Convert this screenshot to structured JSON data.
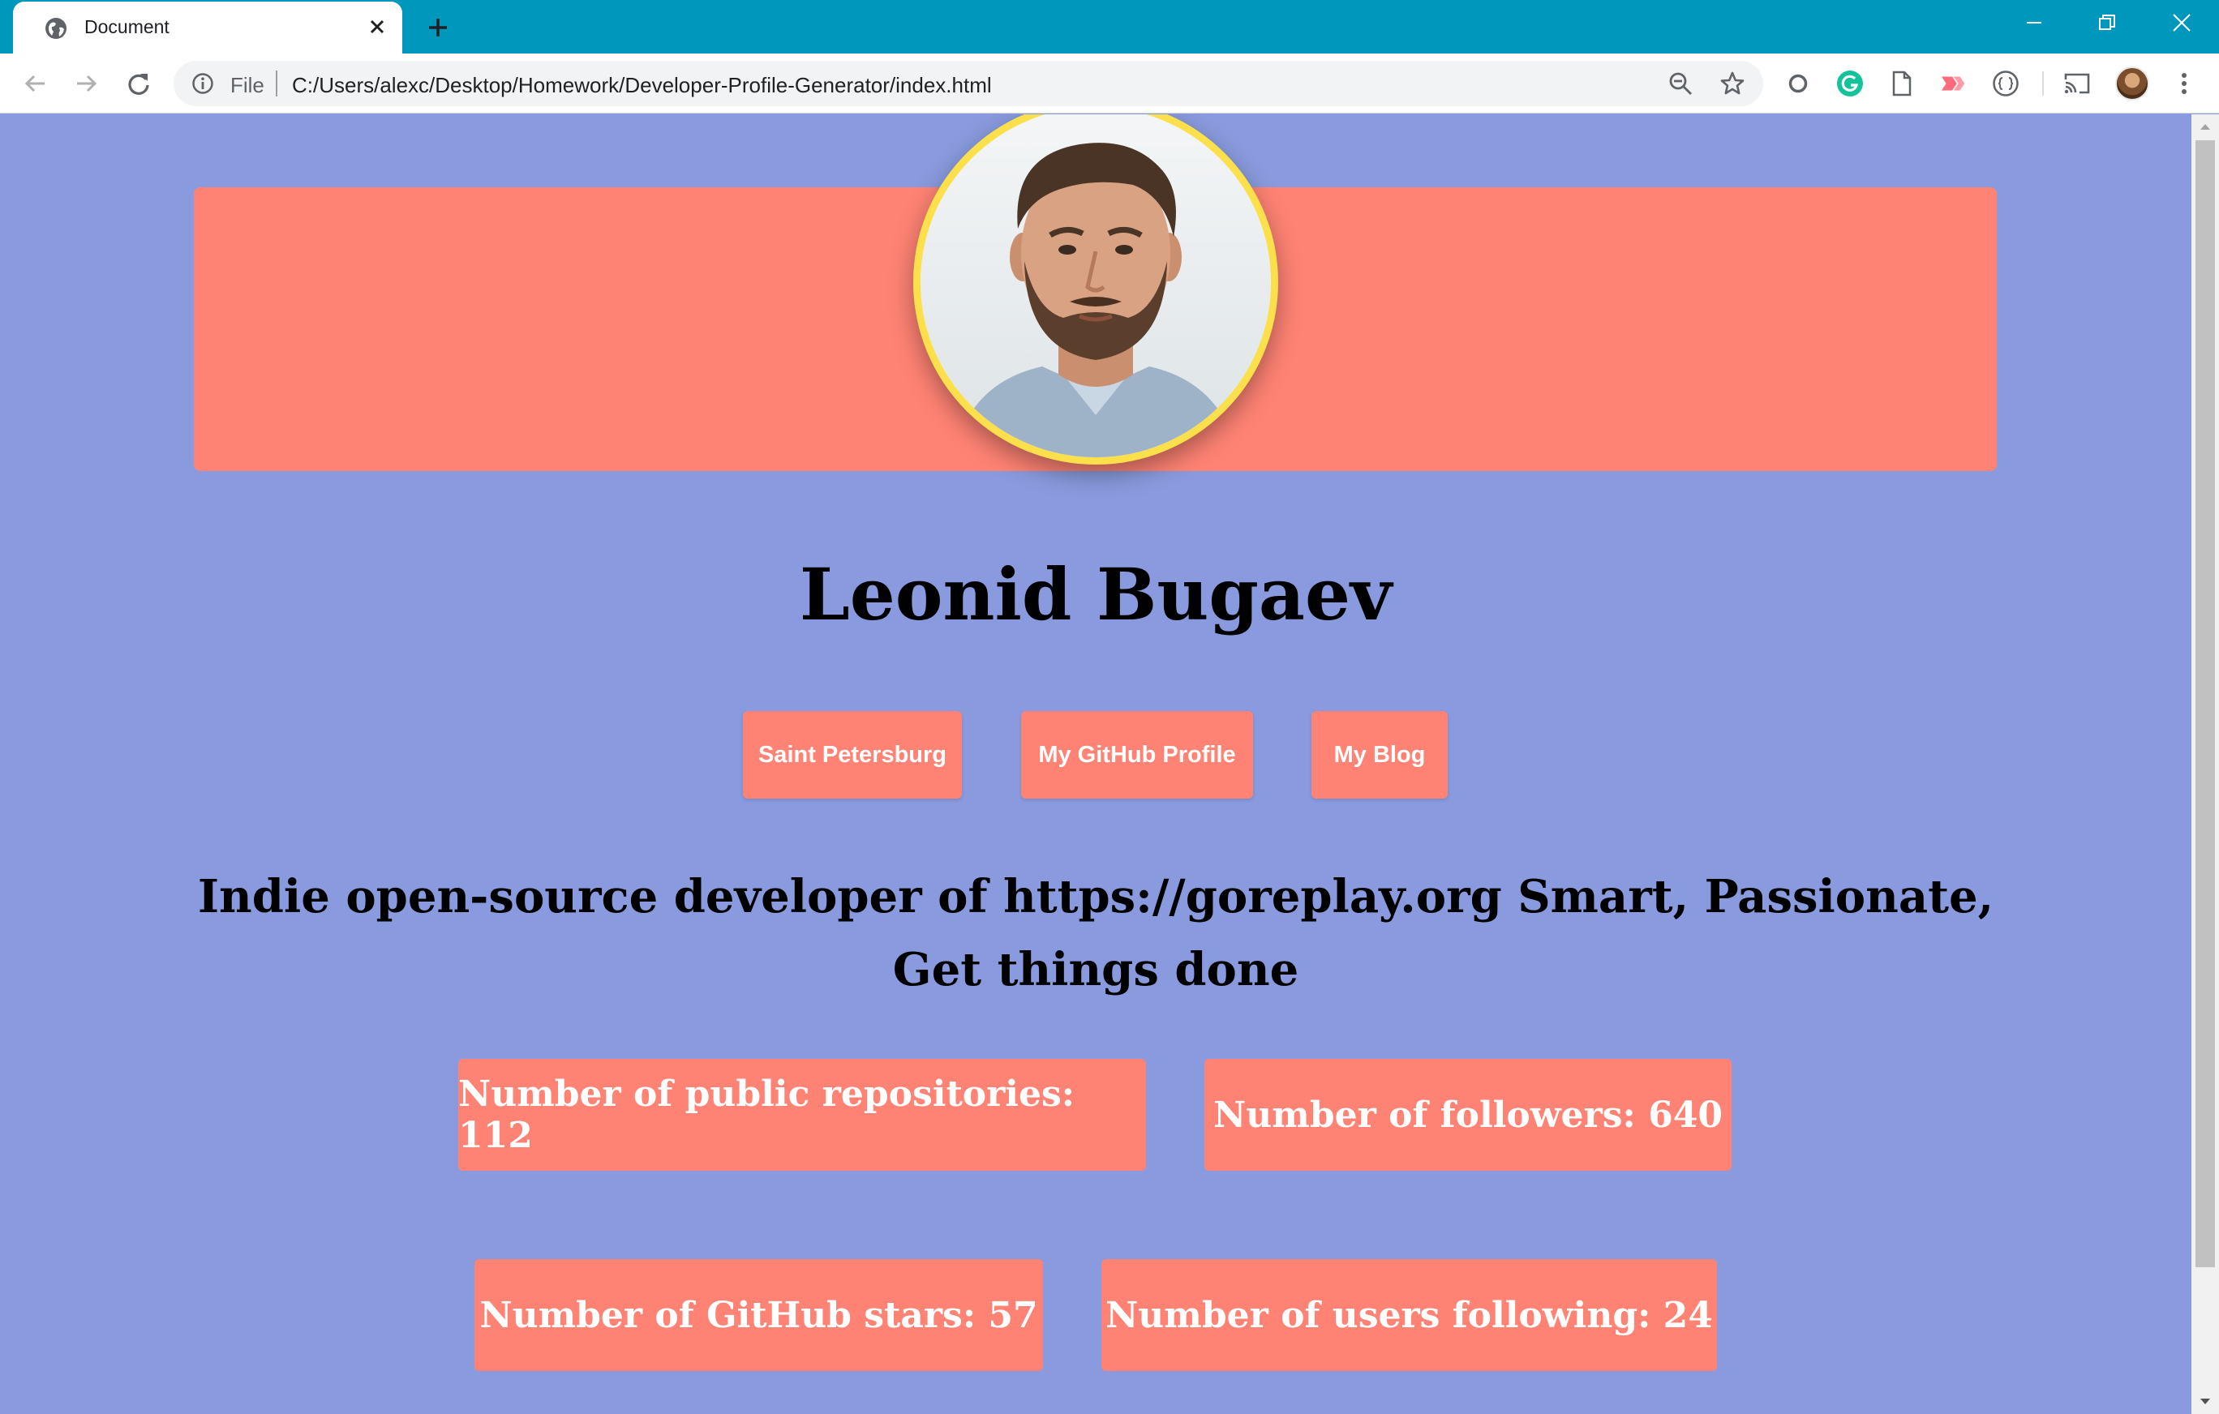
{
  "browser": {
    "tab_title": "Document",
    "omnibox_scheme": "File",
    "url": "C:/Users/alexc/Desktop/Homework/Developer-Profile-Generator/index.html",
    "chrome_color": "#0097bd"
  },
  "profile": {
    "name": "Leonid Bugaev",
    "links": [
      {
        "label": "Saint Petersburg"
      },
      {
        "label": "My GitHub Profile"
      },
      {
        "label": "My Blog"
      }
    ],
    "bio": "Indie open-source developer of https://goreplay.org Smart, Passionate, Get things done",
    "stats": {
      "repos": "Number of public repositories: 112",
      "followers": "Number of followers: 640",
      "stars": "Number of GitHub stars: 57",
      "following": "Number of users following: 24"
    }
  },
  "colors": {
    "page_background": "#899bde",
    "card_color": "#ff8374",
    "avatar_border": "#fbe04c"
  }
}
